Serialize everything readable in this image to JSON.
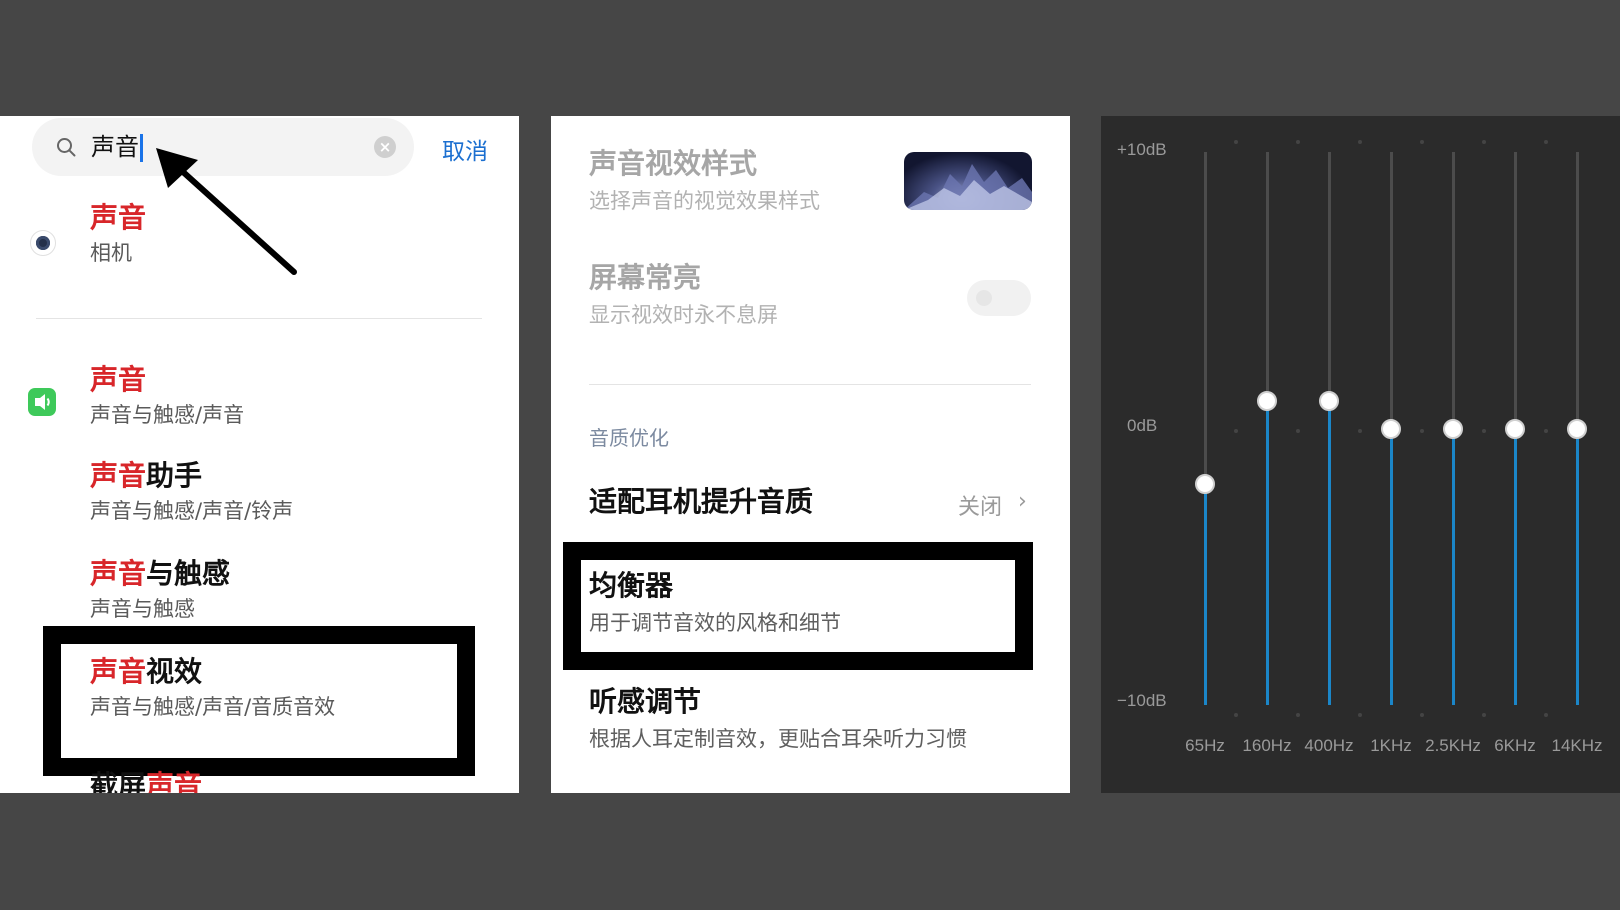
{
  "search_panel": {
    "query": "声音",
    "cancel_label": "取消",
    "results": [
      {
        "highlight": "声音",
        "rest": "",
        "path": "相机"
      },
      {
        "highlight": "声音",
        "rest": "",
        "path": "声音与触感/声音"
      },
      {
        "highlight": "声音",
        "rest": "助手",
        "path": "声音与触感/声音/铃声"
      },
      {
        "highlight": "声音",
        "rest": "与触感",
        "path": "声音与触感"
      },
      {
        "highlight": "声音",
        "rest": "视效",
        "path": "声音与触感/声音/音质音效"
      },
      {
        "prefix": "截屏",
        "highlight": "声音"
      }
    ]
  },
  "settings_panel": {
    "visual_style": {
      "title": "声音视效样式",
      "subtitle": "选择声音的视觉效果样式"
    },
    "screen_on": {
      "title": "屏幕常亮",
      "subtitle": "显示视效时永不息屏"
    },
    "section_label": "音质优化",
    "headphone": {
      "title": "适配耳机提升音质",
      "value": "关闭"
    },
    "equalizer": {
      "title": "均衡器",
      "subtitle": "用于调节音效的风格和细节"
    },
    "hearing": {
      "title": "听感调节",
      "subtitle": "根据人耳定制音效，更贴合耳朵听力习惯"
    }
  },
  "equalizer_panel": {
    "db_labels": {
      "top": "+10dB",
      "mid": "0dB",
      "bottom": "−10dB"
    },
    "bands": [
      {
        "freq": "65Hz",
        "gain_db": -2
      },
      {
        "freq": "160Hz",
        "gain_db": 1
      },
      {
        "freq": "400Hz",
        "gain_db": 1
      },
      {
        "freq": "1KHz",
        "gain_db": 0
      },
      {
        "freq": "2.5KHz",
        "gain_db": 0
      },
      {
        "freq": "6KHz",
        "gain_db": 0
      },
      {
        "freq": "14KHz",
        "gain_db": 0
      }
    ],
    "accent_color": "#1b86c8"
  }
}
